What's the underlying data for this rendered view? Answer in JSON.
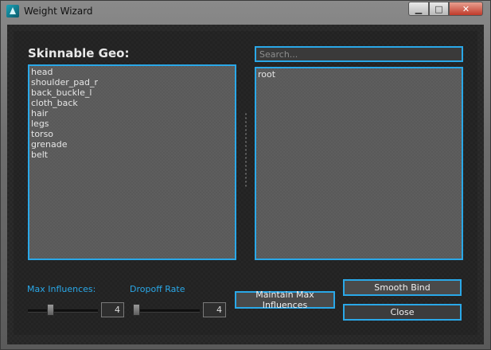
{
  "window": {
    "title": "Weight Wizard",
    "minimize_label": "▁",
    "maximize_label": "□",
    "close_label": "✕"
  },
  "geo": {
    "heading": "Skinnable Geo:",
    "items": [
      "head",
      "shoulder_pad_r",
      "back_buckle_l",
      "cloth_back",
      "hair",
      "legs",
      "torso",
      "grenade",
      "belt"
    ]
  },
  "joints": {
    "search_placeholder": "Search...",
    "items": [
      "root"
    ]
  },
  "controls": {
    "max_influences_label": "Max Influences:",
    "max_influences_value": "4",
    "max_influences_fraction": 0.3,
    "dropoff_rate_label": "Dropoff Rate",
    "dropoff_rate_value": "4",
    "dropoff_rate_fraction": 0.0,
    "maintain_max_label": "Maintain Max Influences",
    "smooth_bind_label": "Smooth Bind",
    "close_label": "Close"
  },
  "colors": {
    "accent": "#2aa8e8"
  }
}
